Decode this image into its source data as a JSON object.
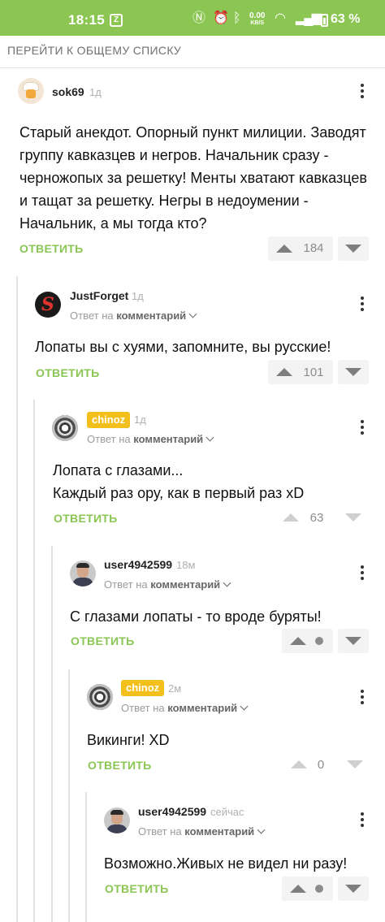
{
  "status_bar": {
    "time": "18:15",
    "netspeed_value": "0.00",
    "netspeed_unit": "KB/S",
    "battery": "63 %"
  },
  "back_link": "ПЕРЕЙТИ К ОБЩЕМУ СПИСКУ",
  "reply_label": "ОТВЕТИТЬ",
  "reply_to_prefix": "Ответ на",
  "reply_to_target": "комментарий",
  "comments": [
    {
      "author": "sok69",
      "time": "1д",
      "text": "Старый анекдот. Опорный пункт милиции. Заводят группу кавказцев и негров. Начальник сразу - черножопых за решетку! Менты хватают кавказцев и тащат за решетку. Негры в недоумении - Начальник, а мы тогда кто?",
      "score": "184"
    },
    {
      "author": "JustForget",
      "time": "1д",
      "text": "Лопаты вы с хуями, запомните, вы русские!",
      "score": "101"
    },
    {
      "author": "chinoz",
      "time": "1д",
      "text_line1": "Лопата с глазами...",
      "text_line2": "Каждый раз ору, как в первый раз xD",
      "score": "63"
    },
    {
      "author": "user4942599",
      "time": "18м",
      "text": "С глазами лопаты - то вроде буряты!"
    },
    {
      "author": "chinoz",
      "time": "2м",
      "text": "Викинги! XD",
      "score": "0"
    },
    {
      "author": "user4942599",
      "time": "сейчас",
      "text": "Возможно.Живых не видел ни разу!"
    }
  ],
  "colors": {
    "accent": "#8cc652",
    "badge": "#f3bf1b",
    "reply": "#8ac654"
  }
}
